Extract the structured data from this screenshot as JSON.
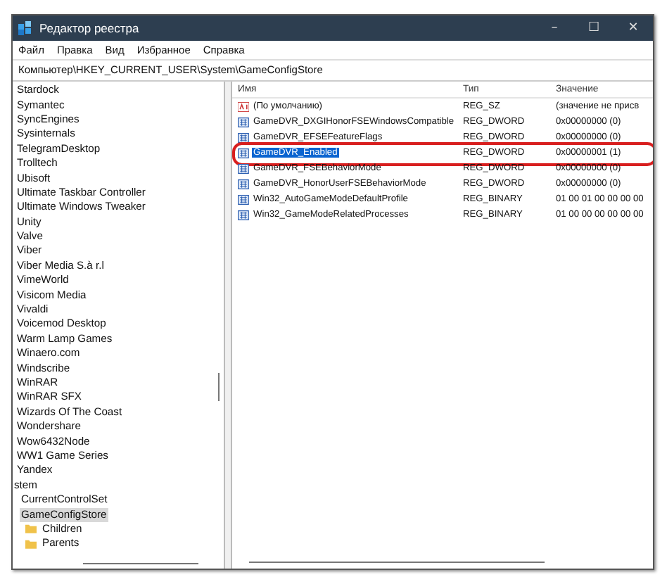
{
  "window": {
    "title": "Редактор реестра",
    "controls": [
      "–",
      "☐",
      "✕"
    ]
  },
  "menu": [
    {
      "label": "Файл"
    },
    {
      "label": "Правка"
    },
    {
      "label": "Вид"
    },
    {
      "label": "Избранное"
    },
    {
      "label": "Справка"
    }
  ],
  "address": "Компьютер\\HKEY_CURRENT_USER\\System\\GameConfigStore",
  "tree": {
    "items": [
      {
        "label": "Stardock",
        "kind": "key",
        "selected": false
      },
      {
        "label": "Symantec",
        "kind": "key",
        "selected": false
      },
      {
        "label": "SyncEngines",
        "kind": "key",
        "selected": false
      },
      {
        "label": "Sysinternals",
        "kind": "key",
        "selected": false
      },
      {
        "label": "TelegramDesktop",
        "kind": "key",
        "selected": false
      },
      {
        "label": "Trolltech",
        "kind": "key",
        "selected": false
      },
      {
        "label": "Ubisoft",
        "kind": "key",
        "selected": false
      },
      {
        "label": "Ultimate Taskbar Controller",
        "kind": "key",
        "selected": false
      },
      {
        "label": "Ultimate Windows Tweaker",
        "kind": "key",
        "selected": false
      },
      {
        "label": "Unity",
        "kind": "key",
        "selected": false
      },
      {
        "label": "Valve",
        "kind": "key",
        "selected": false
      },
      {
        "label": "Viber",
        "kind": "key",
        "selected": false
      },
      {
        "label": "Viber Media S.à r.l",
        "kind": "key",
        "selected": false
      },
      {
        "label": "VimeWorld",
        "kind": "key",
        "selected": false
      },
      {
        "label": "Visicom Media",
        "kind": "key",
        "selected": false
      },
      {
        "label": "Vivaldi",
        "kind": "key",
        "selected": false
      },
      {
        "label": "Voicemod Desktop",
        "kind": "key",
        "selected": false
      },
      {
        "label": "Warm Lamp Games",
        "kind": "key",
        "selected": false
      },
      {
        "label": "Winaero.com",
        "kind": "key",
        "selected": false
      },
      {
        "label": "Windscribe",
        "kind": "key",
        "selected": false
      },
      {
        "label": "WinRAR",
        "kind": "key",
        "selected": false
      },
      {
        "label": "WinRAR SFX",
        "kind": "key",
        "selected": false
      },
      {
        "label": "Wizards Of The Coast",
        "kind": "key",
        "selected": false
      },
      {
        "label": "Wondershare",
        "kind": "key",
        "selected": false
      },
      {
        "label": "Wow6432Node",
        "kind": "key",
        "selected": false
      },
      {
        "label": "WW1 Game Series",
        "kind": "key",
        "selected": false
      },
      {
        "label": "Yandex",
        "kind": "key",
        "selected": false
      },
      {
        "label": "stem",
        "kind": "parent",
        "selected": false,
        "children": [
          {
            "label": "CurrentControlSet",
            "kind": "key",
            "selected": false
          },
          {
            "label": "GameConfigStore",
            "kind": "key",
            "selected": true,
            "children": [
              {
                "label": "Children",
                "kind": "folder",
                "selected": false
              },
              {
                "label": "Parents",
                "kind": "folder",
                "selected": false
              }
            ]
          }
        ]
      }
    ]
  },
  "values": {
    "columns": [
      "Имя",
      "Тип",
      "Значение"
    ],
    "rows": [
      {
        "name": "(По умолчанию)",
        "type": "REG_SZ",
        "data": "(значение не присв",
        "kind": "string",
        "selected": false
      },
      {
        "name": "GameDVR_DXGIHonorFSEWindowsCompatible",
        "type": "REG_DWORD",
        "data": "0x00000000 (0)",
        "kind": "number",
        "selected": false
      },
      {
        "name": "GameDVR_EFSEFeatureFlags",
        "type": "REG_DWORD",
        "data": "0x00000000 (0)",
        "kind": "number",
        "selected": false
      },
      {
        "name": "GameDVR_Enabled",
        "type": "REG_DWORD",
        "data": "0x00000001 (1)",
        "kind": "number",
        "selected": true,
        "highlighted": true
      },
      {
        "name": "GameDVR_FSEBehaviorMode",
        "type": "REG_DWORD",
        "data": "0x00000000 (0)",
        "kind": "number",
        "selected": false
      },
      {
        "name": "GameDVR_HonorUserFSEBehaviorMode",
        "type": "REG_DWORD",
        "data": "0x00000000 (0)",
        "kind": "number",
        "selected": false
      },
      {
        "name": "Win32_AutoGameModeDefaultProfile",
        "type": "REG_BINARY",
        "data": "01 00 01 00 00 00 00",
        "kind": "number",
        "selected": false
      },
      {
        "name": "Win32_GameModeRelatedProcesses",
        "type": "REG_BINARY",
        "data": "01 00 00 00 00 00 00",
        "kind": "number",
        "selected": false
      }
    ]
  }
}
